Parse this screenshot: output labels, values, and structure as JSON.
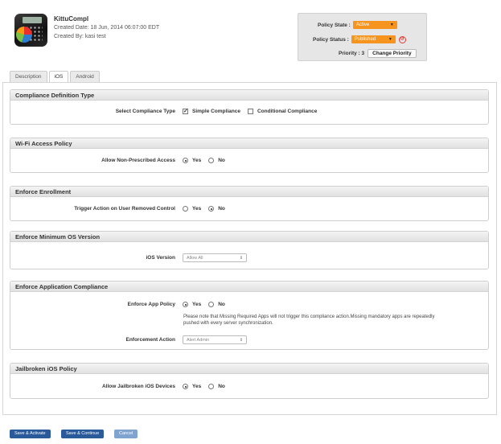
{
  "header": {
    "app_name": "KittuCompl",
    "created_date": "Created Date: 18 Jun, 2014 06:07:00 EDT",
    "created_by": "Created By: kasi test"
  },
  "policy": {
    "state_label": "Policy State :",
    "state_value": "Active",
    "status_label": "Policy Status :",
    "status_value": "Published",
    "priority_label": "Priority : 3",
    "change_priority_label": "Change Priority"
  },
  "tabs": [
    {
      "label": "Description",
      "active": false
    },
    {
      "label": "iOS",
      "active": true
    },
    {
      "label": "Android",
      "active": false
    }
  ],
  "sections": {
    "compliance_type": {
      "title": "Compliance Definition Type",
      "label": "Select Compliance Type",
      "opt1": "Simple Compliance",
      "opt2": "Conditional Compliance"
    },
    "wifi": {
      "title": "Wi-Fi Access Policy",
      "label": "Allow Non-Prescribed Access",
      "yes": "Yes",
      "no": "No"
    },
    "enrollment": {
      "title": "Enforce Enrollment",
      "label": "Trigger Action on User Removed Control",
      "yes": "Yes",
      "no": "No"
    },
    "min_os": {
      "title": "Enforce Minimum OS Version",
      "label": "iOS Version",
      "select_value": "Allow All"
    },
    "app_compliance": {
      "title": "Enforce Application Compliance",
      "label": "Enforce App Policy",
      "yes": "Yes",
      "no": "No",
      "note_line1": "Please note that Missing Required Apps will not trigger this compliance action.Missing mandatory apps are repeatedly",
      "note_line2": "pushed with every server synchronization.",
      "action_label": "Enforcement Action",
      "action_value": "Alert Admin"
    },
    "jailbroken": {
      "title": "Jailbroken iOS Policy",
      "label": "Allow Jailbroken iOS Devices",
      "yes": "Yes",
      "no": "No"
    }
  },
  "footer": {
    "save_activate": "Save & Activate",
    "save_continue": "Save & Continue",
    "cancel": "Cancel"
  },
  "colors": {
    "accent_orange": "#f7941d",
    "button_blue": "#2a5a9a",
    "button_light_blue": "#7fa4cf"
  }
}
